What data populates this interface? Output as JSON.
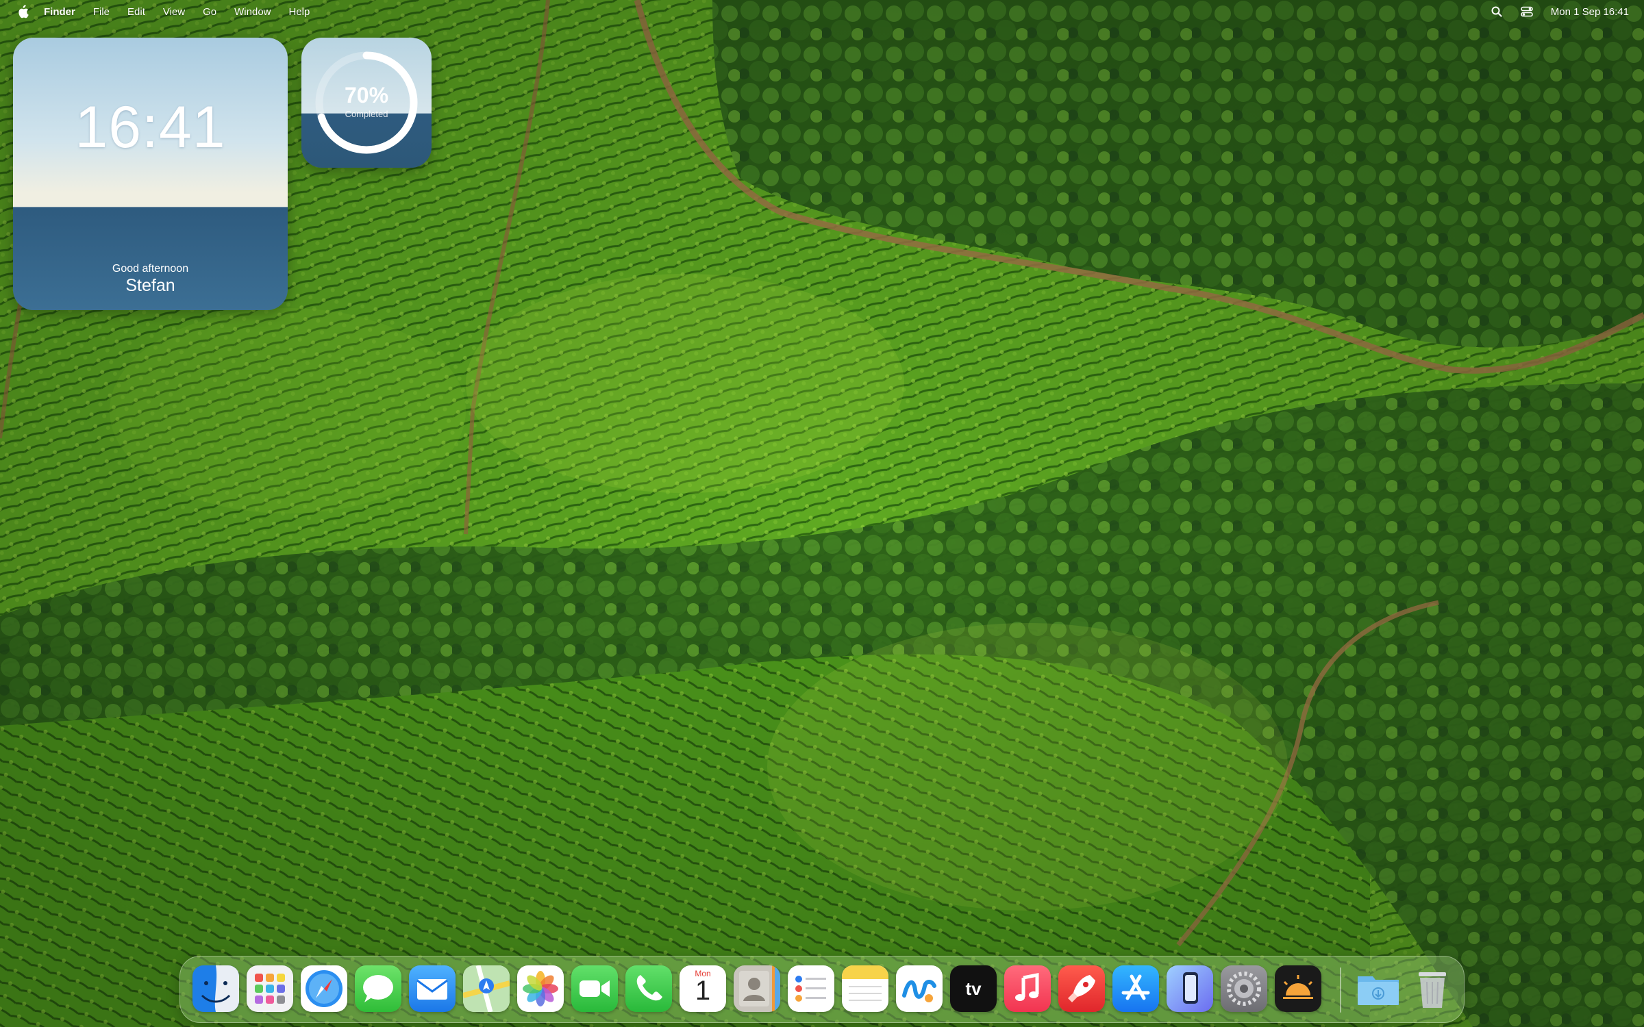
{
  "menubar": {
    "app_name": "Finder",
    "menus": [
      "File",
      "Edit",
      "View",
      "Go",
      "Window",
      "Help"
    ],
    "datetime": "Mon 1 Sep  16:41",
    "status_icons": [
      "search-icon",
      "control-center-icon"
    ]
  },
  "widgets": {
    "clock": {
      "time": "16:41",
      "greeting": "Good afternoon",
      "name": "Stefan"
    },
    "progress": {
      "value": "70%",
      "caption": "Completed",
      "fraction": 0.7
    }
  },
  "dock": {
    "apps": [
      "Finder",
      "Launchpad",
      "Safari",
      "Messages",
      "Mail",
      "Maps",
      "Photos",
      "FaceTime",
      "Phone",
      "Calendar",
      "Contacts",
      "Reminders",
      "Notes",
      "Freeform",
      "TV",
      "Music",
      "Rocket",
      "App Store",
      "iPhone Mirroring",
      "System Settings",
      "Sunset",
      "Downloads",
      "Trash"
    ],
    "calendar": {
      "month": "Mon",
      "day": "1"
    },
    "tv": {
      "label": "tv"
    }
  },
  "colors": {
    "wallpaper_green": "#4e9a22",
    "widget_blue": "#2e5b7f",
    "dock_tint": "#a0cd82"
  }
}
